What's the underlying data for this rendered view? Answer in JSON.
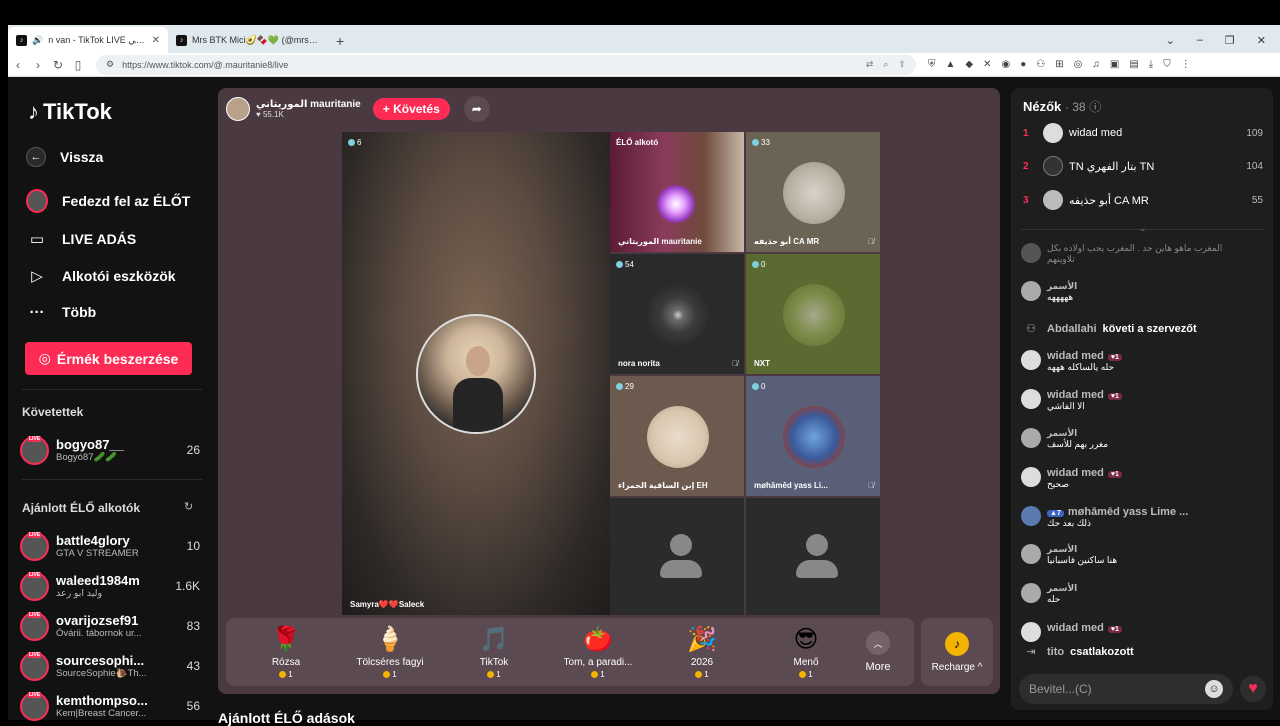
{
  "browser": {
    "tabs": [
      {
        "title": "n van - TikTok LIVE الموريتاني",
        "active": true
      },
      {
        "title": "Mrs BTK Mici🥑🍫💚 (@mrsbtk) ..",
        "active": false
      }
    ],
    "url": "https://www.tiktok.com/@.mauritanie8/live"
  },
  "sidebar": {
    "logo": "TikTok",
    "back": "Vissza",
    "nav": [
      {
        "label": "Fedezd fel az ÉLŐT",
        "icon": "live-explore-icon"
      },
      {
        "label": "LIVE ADÁS",
        "icon": "video-camera-icon"
      },
      {
        "label": "Alkotói eszközök",
        "icon": "creator-tools-icon"
      },
      {
        "label": "Több",
        "icon": "more-dots-icon"
      }
    ],
    "coins_button": "Érmék beszerzése",
    "following_title": "Követettek",
    "following": [
      {
        "name": "bogyo87__",
        "sub": "Bogyó87🥒🥒",
        "count": "26"
      }
    ],
    "recommended_title": "Ajánlott ÉLŐ alkotók",
    "recommended": [
      {
        "name": "battle4glory",
        "sub": "GTA V STREAMER",
        "count": "10"
      },
      {
        "name": "waleed1984m",
        "sub": "وليد ابو رعد",
        "count": "1.6K"
      },
      {
        "name": "ovarijozsef91",
        "sub": "Óvárii. tábornok ur...",
        "count": "83"
      },
      {
        "name": "sourcesophi...",
        "sub": "SourceSophie🐌Th...",
        "count": "43"
      },
      {
        "name": "kemthompso...",
        "sub": "Kem|Breast Cancer...",
        "count": "56"
      }
    ]
  },
  "host": {
    "name": "الموريتاني mauritanie",
    "likes": "55.1K",
    "follow": "+ Követés"
  },
  "stream": {
    "main_viewers": "6",
    "main_label": "Samyra❤️❤️Saleck",
    "tiles": [
      {
        "label": "ÉLŐ alkotó",
        "sublabel": "الموريتاني mauritanie",
        "viewers": "",
        "style": "creator"
      },
      {
        "label": "أبو حذيفه CA MR",
        "viewers": "33",
        "style": "paper"
      },
      {
        "label": "nora norita",
        "viewers": "54",
        "style": "moon"
      },
      {
        "label": "NXT",
        "viewers": "0",
        "style": "field"
      },
      {
        "label": "إبن الساقية الحمراء EH",
        "viewers": "29",
        "style": "redtext"
      },
      {
        "label": "møhāmēd yass Li...",
        "viewers": "0",
        "style": "people"
      },
      {
        "label": "",
        "viewers": "",
        "style": "empty"
      },
      {
        "label": "",
        "viewers": "",
        "style": "empty"
      }
    ]
  },
  "gifts": [
    {
      "name": "Rózsa",
      "price": "1",
      "icon": "🌹"
    },
    {
      "name": "Tölcséres fagyi",
      "price": "1",
      "icon": "🍦"
    },
    {
      "name": "TikTok",
      "price": "1",
      "icon": "🎵"
    },
    {
      "name": "Tom, a paradi...",
      "price": "1",
      "icon": "🍅"
    },
    {
      "name": "2026",
      "price": "1",
      "icon": "🎉"
    },
    {
      "name": "Menő",
      "price": "1",
      "icon": "😎"
    }
  ],
  "gift_more": "More",
  "recharge": "Recharge ^",
  "below_title": "Ajánlott ÉLŐ adások",
  "viewers_panel": {
    "title": "Nézők",
    "count": "· 38",
    "top": [
      {
        "rank": "1",
        "name": "widad med",
        "points": "109"
      },
      {
        "rank": "2",
        "name": "TN بتار الفهري TN",
        "points": "104"
      },
      {
        "rank": "3",
        "name": "أبو حذيفه CA MR",
        "points": "55"
      }
    ]
  },
  "chat": [
    {
      "name": "",
      "text": "المغرب ماهو هاين حد . المغرب يحب اولاده بكل\nتلاوينهم",
      "type": "msg"
    },
    {
      "name": "الأسمر",
      "text": "هههههه",
      "type": "msg"
    },
    {
      "name": "Abdallahi",
      "text": "követi a szervezőt",
      "type": "system"
    },
    {
      "name": "widad med",
      "text": "حله يالساكله هههه",
      "type": "msg",
      "badge": "1"
    },
    {
      "name": "widad med",
      "text": "الا الفاشي",
      "type": "msg",
      "badge": "1"
    },
    {
      "name": "الأسمر",
      "text": "مغرر بهم للأسف",
      "type": "msg"
    },
    {
      "name": "widad med",
      "text": "صحيح",
      "type": "msg",
      "badge": "1"
    },
    {
      "name": "møhāmēd yass Lime ...",
      "text": "ذلك بعد حك",
      "type": "msg",
      "badge": "7"
    },
    {
      "name": "الأسمر",
      "text": "هنا ساكنين فاسبانيا",
      "type": "msg"
    },
    {
      "name": "الأسمر",
      "text": "حله",
      "type": "msg"
    },
    {
      "name": "widad med",
      "text": "",
      "type": "msg",
      "badge": "1"
    },
    {
      "name": "tito",
      "text": "csatlakozott",
      "type": "system"
    }
  ],
  "input_placeholder": "Bevitel...(C)"
}
